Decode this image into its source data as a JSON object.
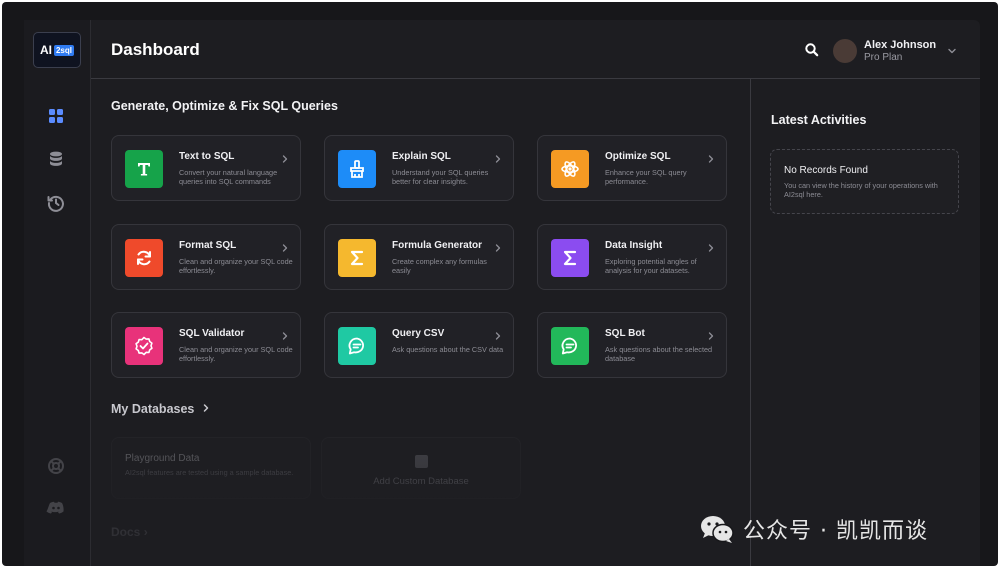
{
  "logo": {
    "ai": "AI",
    "sql": "2sql"
  },
  "header": {
    "title": "Dashboard",
    "user_name": "Alex Johnson",
    "user_plan": "Pro Plan"
  },
  "sidebar": {
    "icons": [
      "grid-icon",
      "database-icon",
      "history-icon",
      "help-icon",
      "discord-icon"
    ]
  },
  "main": {
    "section_title": "Generate, Optimize & Fix SQL Queries",
    "tools": [
      {
        "title": "Text to SQL",
        "desc": "Convert your natural language queries into SQL commands",
        "color": "#16a34a",
        "icon": "text-t-icon"
      },
      {
        "title": "Explain SQL",
        "desc": "Understand your SQL queries better for clear insights.",
        "color": "#1d8cf8",
        "icon": "brush-icon"
      },
      {
        "title": "Optimize SQL",
        "desc": "Enhance your SQL query performance.",
        "color": "#f59a23",
        "icon": "atom-icon"
      },
      {
        "title": "Format SQL",
        "desc": "Clean and organize your SQL code effortlessly.",
        "color": "#ef4a2b",
        "icon": "refresh-icon"
      },
      {
        "title": "Formula Generator",
        "desc": "Create complex any formulas easily",
        "color": "#f5b82e",
        "icon": "sigma-icon"
      },
      {
        "title": "Data Insight",
        "desc": "Exploring potential angles of analysis for your datasets.",
        "color": "#8b4cf0",
        "icon": "sigma-icon"
      },
      {
        "title": "SQL Validator",
        "desc": "Clean and organize your SQL code effortlessly.",
        "color": "#e8327a",
        "icon": "badge-check-icon"
      },
      {
        "title": "Query CSV",
        "desc": "Ask questions about the CSV data",
        "color": "#1fc9a3",
        "icon": "chat-bubble-icon"
      },
      {
        "title": "SQL Bot",
        "desc": "Ask questions about the selected database",
        "color": "#22b85a",
        "icon": "chat-bubble-icon"
      }
    ],
    "databases_title": "My Databases",
    "playground": {
      "name": "Playground Data",
      "desc": "AI2sql features are tested using a sample database."
    },
    "add_db_label": "Add Custom Database",
    "docs_title": "Docs"
  },
  "activities": {
    "title": "Latest Activities",
    "empty_title": "No Records Found",
    "empty_desc": "You can view the history of your operations with AI2sql here."
  },
  "watermark": {
    "text": "公众号 · 凯凯而谈"
  }
}
